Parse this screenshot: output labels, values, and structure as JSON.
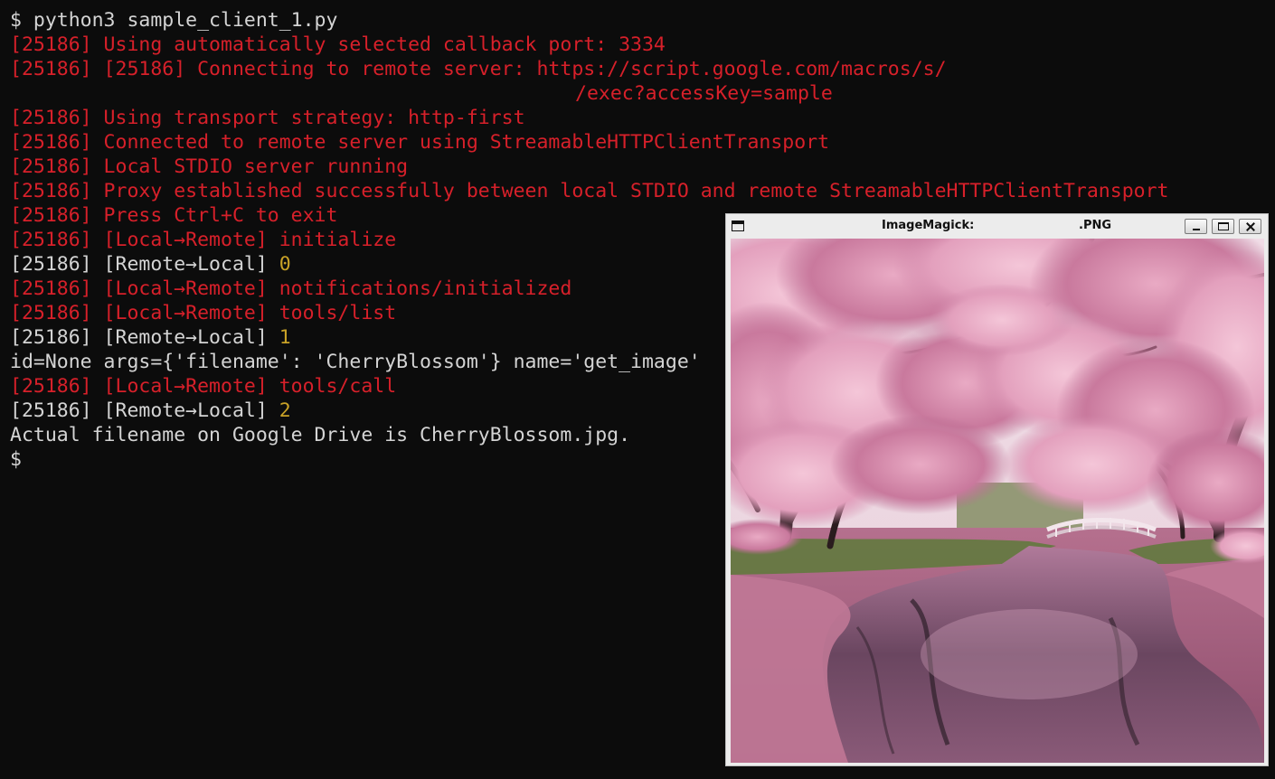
{
  "terminal": {
    "lines": [
      {
        "segments": [
          {
            "text": "$ python3 sample_client_1.py",
            "color": "white"
          }
        ]
      },
      {
        "segments": [
          {
            "text": "[25186] Using automatically selected callback port: 3334",
            "color": "red"
          }
        ]
      },
      {
        "segments": [
          {
            "text": "[25186] [25186] Connecting to remote server: https://script.google.com/macros/s/",
            "color": "red"
          }
        ]
      },
      {
        "segments": [
          {
            "text": "/exec?accessKey=sample",
            "color": "red"
          }
        ],
        "indent": true
      },
      {
        "segments": [
          {
            "text": "[25186] Using transport strategy: http-first",
            "color": "red"
          }
        ]
      },
      {
        "segments": [
          {
            "text": "[25186] Connected to remote server using StreamableHTTPClientTransport",
            "color": "red"
          }
        ]
      },
      {
        "segments": [
          {
            "text": "[25186] Local STDIO server running",
            "color": "red"
          }
        ]
      },
      {
        "segments": [
          {
            "text": "[25186] Proxy established successfully between local STDIO and remote StreamableHTTPClientTransport",
            "color": "red"
          }
        ]
      },
      {
        "segments": [
          {
            "text": "[25186] Press Ctrl+C to exit",
            "color": "red"
          }
        ]
      },
      {
        "segments": [
          {
            "text": "[25186] [Local→Remote] initialize",
            "color": "red"
          }
        ]
      },
      {
        "segments": [
          {
            "text": "[25186] [Remote→Local] ",
            "color": "white"
          },
          {
            "text": "0",
            "color": "yellow"
          }
        ]
      },
      {
        "segments": [
          {
            "text": "[25186] [Local→Remote] notifications/initialized",
            "color": "red"
          }
        ]
      },
      {
        "segments": [
          {
            "text": "[25186] [Local→Remote] tools/list",
            "color": "red"
          }
        ]
      },
      {
        "segments": [
          {
            "text": "[25186] [Remote→Local] ",
            "color": "white"
          },
          {
            "text": "1",
            "color": "yellow"
          }
        ]
      },
      {
        "segments": [
          {
            "text": "id=None args={'filename': 'CherryBlossom'} name='get_image'",
            "color": "white"
          }
        ]
      },
      {
        "segments": [
          {
            "text": "[25186] [Local→Remote] tools/call",
            "color": "red"
          }
        ]
      },
      {
        "segments": [
          {
            "text": "[25186] [Remote→Local] ",
            "color": "white"
          },
          {
            "text": "2",
            "color": "yellow"
          }
        ]
      },
      {
        "segments": [
          {
            "text": "Actual filename on Google Drive is CherryBlossom.jpg.",
            "color": "white"
          }
        ]
      },
      {
        "segments": [
          {
            "text": "$",
            "color": "white"
          }
        ]
      }
    ]
  },
  "image_window": {
    "title_left": "ImageMagick:",
    "title_right": ".PNG",
    "icon": "window-menu-icon",
    "buttons": [
      "minimize-icon",
      "maximize-icon",
      "close-icon"
    ]
  },
  "colors": {
    "background": "#0c0c0c",
    "red": "#d7202a",
    "white": "#d4d4d4",
    "yellow": "#c9a227"
  }
}
